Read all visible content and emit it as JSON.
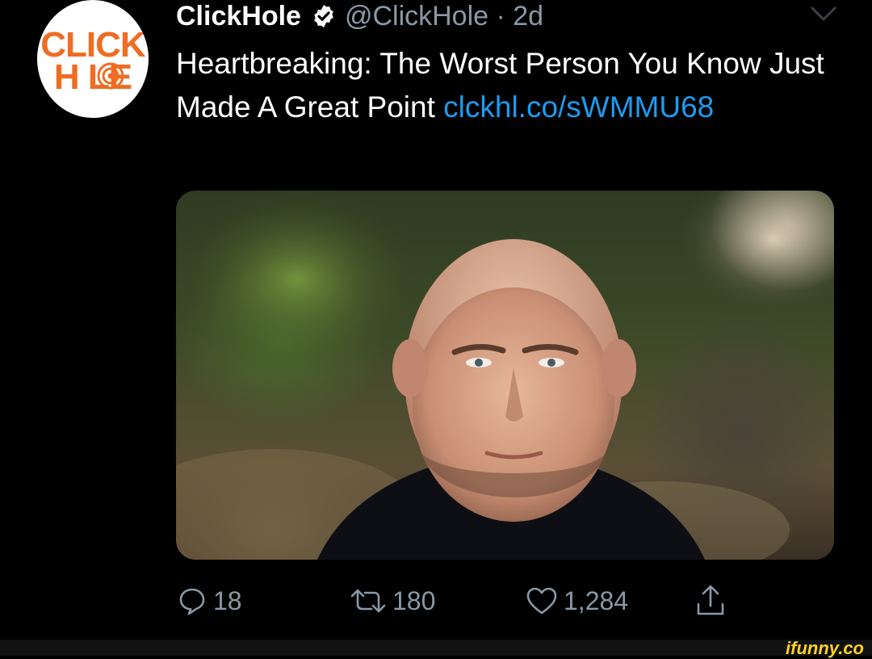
{
  "tweet": {
    "avatar": {
      "line1": "CLICK",
      "line2": "H LE",
      "brand_color": "#ef6c22"
    },
    "display_name": "ClickHole",
    "handle_time": "@ClickHole · 2d",
    "text_before_link": "Heartbreaking: The Worst Person You Know Just Made A Great Point ",
    "link_text": "clckhl.co/sWMMU68",
    "link_color": "#1d9bf0",
    "icons": {
      "verified": "verified-badge-icon",
      "more": "chevron-down-icon",
      "reply": "reply-icon",
      "retweet": "retweet-icon",
      "like": "heart-icon",
      "share": "share-icon"
    },
    "stats": {
      "replies": "18",
      "retweets": "180",
      "likes": "1,284"
    }
  },
  "watermark": "ifunny.co"
}
